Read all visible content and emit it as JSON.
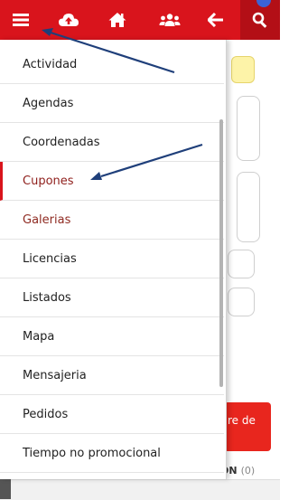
{
  "topbar": {
    "color": "#d9141c",
    "buttons": [
      {
        "icon": "hamburger-menu-icon"
      },
      {
        "icon": "cloud-upload-icon"
      },
      {
        "icon": "home-icon"
      },
      {
        "icon": "group-users-icon"
      },
      {
        "icon": "arrow-left-icon"
      },
      {
        "icon": "search-icon"
      }
    ]
  },
  "menu": {
    "items": [
      {
        "label": "Actividad"
      },
      {
        "label": "Agendas"
      },
      {
        "label": "Coordenadas"
      },
      {
        "label": "Cupones"
      },
      {
        "label": "Galerias"
      },
      {
        "label": "Licencias"
      },
      {
        "label": "Listados"
      },
      {
        "label": "Mapa"
      },
      {
        "label": "Mensajeria"
      },
      {
        "label": "Pedidos"
      },
      {
        "label": "Tiempo no promocional"
      }
    ],
    "active_item": "Cupones"
  },
  "background": {
    "red_button_label": "re de",
    "row_label": "ON",
    "row_count": "(0)"
  },
  "annotations": {
    "arrow_color": "#1f3f7a"
  }
}
